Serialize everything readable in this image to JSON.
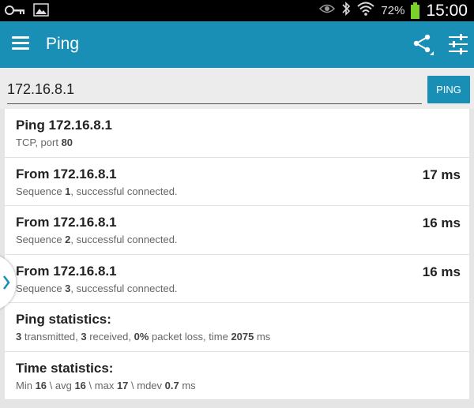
{
  "status_bar": {
    "battery_percent": "72%",
    "clock": "15:00",
    "icons": [
      "key-icon",
      "image-icon",
      "eye-icon",
      "bluetooth-icon",
      "wifi-icon",
      "battery-icon"
    ]
  },
  "app_bar": {
    "title": "Ping",
    "icons": [
      "menu-icon",
      "share-icon",
      "settings-sliders-icon"
    ]
  },
  "input": {
    "host_value": "172.16.8.1",
    "ping_button": "PING"
  },
  "results": [
    {
      "title": "Ping 172.16.8.1",
      "sub": [
        {
          "t": "TCP, port "
        },
        {
          "t": "80",
          "b": true
        }
      ],
      "time": ""
    },
    {
      "title": "From 172.16.8.1",
      "sub": [
        {
          "t": "Sequence "
        },
        {
          "t": "1",
          "b": true
        },
        {
          "t": ", successful connected."
        }
      ],
      "time": "17 ms"
    },
    {
      "title": "From 172.16.8.1",
      "sub": [
        {
          "t": "Sequence "
        },
        {
          "t": "2",
          "b": true
        },
        {
          "t": ", successful connected."
        }
      ],
      "time": "16 ms"
    },
    {
      "title": "From 172.16.8.1",
      "sub": [
        {
          "t": "Sequence "
        },
        {
          "t": "3",
          "b": true
        },
        {
          "t": ", successful connected."
        }
      ],
      "time": "16 ms"
    },
    {
      "title": "Ping statistics:",
      "sub": [
        {
          "t": "3",
          "b": true
        },
        {
          "t": " transmitted, "
        },
        {
          "t": "3",
          "b": true
        },
        {
          "t": " received, "
        },
        {
          "t": "0%",
          "b": true
        },
        {
          "t": " packet loss, time "
        },
        {
          "t": "2075",
          "b": true
        },
        {
          "t": " ms"
        }
      ],
      "time": ""
    },
    {
      "title": "Time statistics:",
      "sub": [
        {
          "t": "Min "
        },
        {
          "t": "16",
          "b": true
        },
        {
          "t": " \\ avg "
        },
        {
          "t": "16",
          "b": true
        },
        {
          "t": " \\ max "
        },
        {
          "t": "17",
          "b": true
        },
        {
          "t": " \\ mdev "
        },
        {
          "t": "0.7",
          "b": true
        },
        {
          "t": " ms"
        }
      ],
      "time": ""
    }
  ],
  "colors": {
    "accent": "#1a8fb5",
    "status_bar": "#000000",
    "battery": "#7bd12a"
  }
}
